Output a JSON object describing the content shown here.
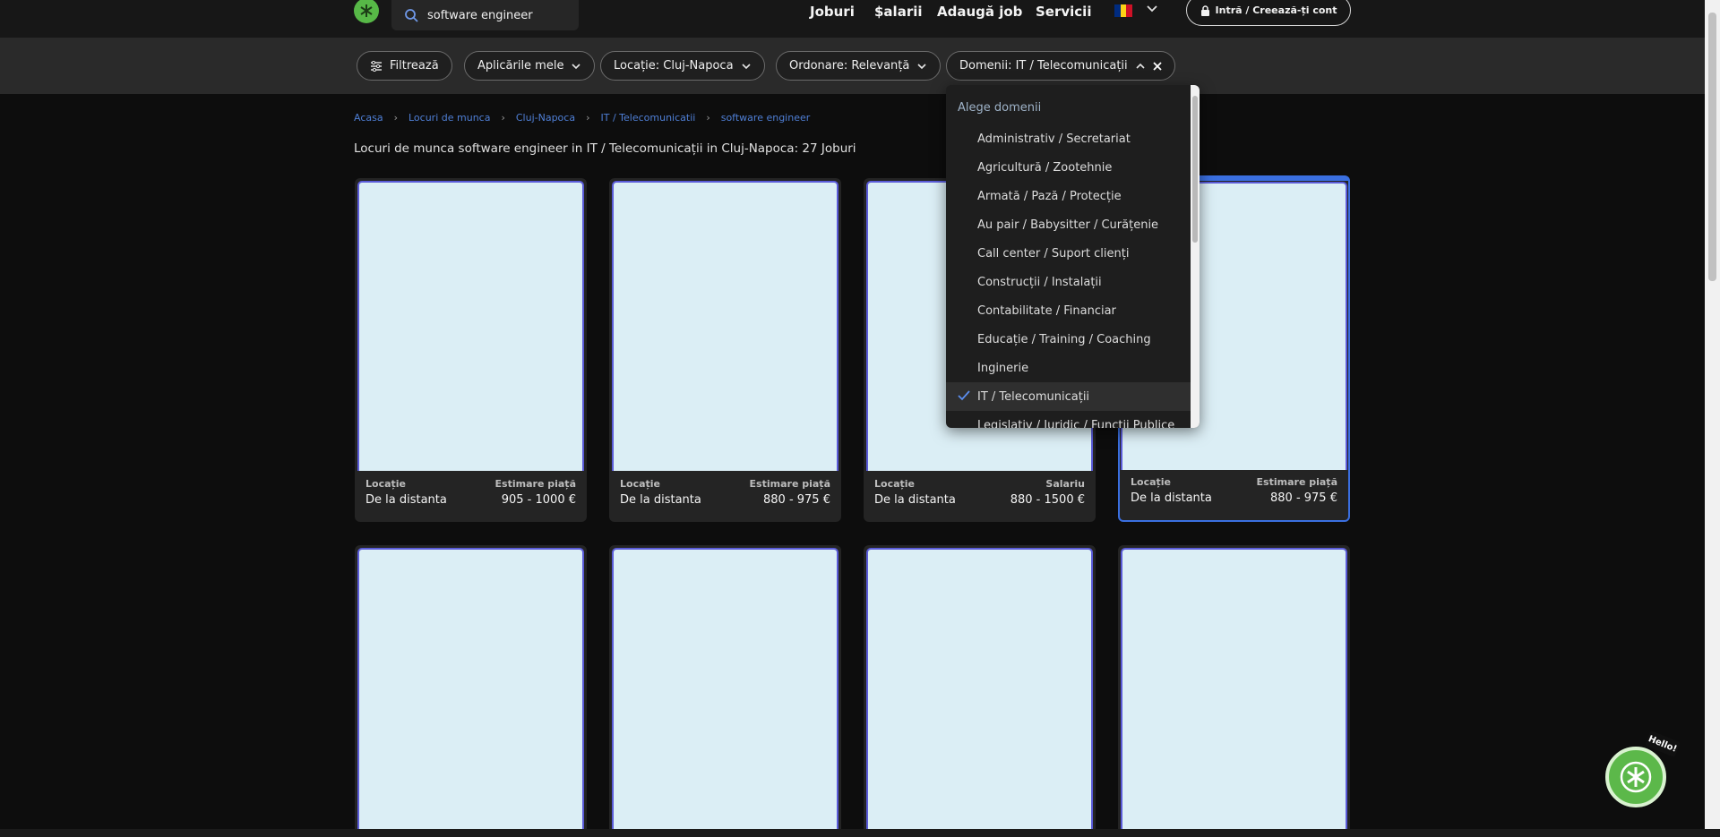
{
  "header": {
    "search_value": "software engineer",
    "nav": [
      "Joburi",
      "$alarii",
      "Adaugă job",
      "Servicii"
    ],
    "login_label": "Intră / Creează-ți cont",
    "flag_colors": [
      "#002b7f",
      "#fcd116",
      "#ce1126"
    ]
  },
  "filters": {
    "filter_label": "Filtrează",
    "applications_label": "Aplicările mele",
    "location_label": "Locație: Cluj-Napoca",
    "order_label": "Ordonare: Relevanță",
    "domains_label": "Domenii: IT / Telecomunicații"
  },
  "breadcrumb": [
    "Acasa",
    "Locuri de munca",
    "Cluj-Napoca",
    "IT / Telecomunicatii",
    "software engineer"
  ],
  "results_heading": "Locuri de munca software engineer in IT / Telecomunicații in Cluj-Napoca: 27 Joburi",
  "cards": [
    {
      "location_label": "Locație",
      "location": "De la distanta",
      "salary_label": "Estimare piață",
      "salary": "905 - 1000 €"
    },
    {
      "location_label": "Locație",
      "location": "De la distanta",
      "salary_label": "Estimare piață",
      "salary": "880 - 975 €"
    },
    {
      "location_label": "Locație",
      "location": "De la distanta",
      "salary_label": "Salariu",
      "salary": "880 - 1500 €"
    },
    {
      "location_label": "Locație",
      "location": "De la distanta",
      "salary_label": "Estimare piață",
      "salary": "880 - 975 €"
    }
  ],
  "dropdown": {
    "title": "Alege domenii",
    "items": [
      "Administrativ / Secretariat",
      "Agricultură / Zootehnie",
      "Armată / Pază / Protecție",
      "Au pair / Babysitter / Curățenie",
      "Call center / Suport clienți",
      "Construcții / Instalații",
      "Contabilitate / Financiar",
      "Educație / Training / Coaching",
      "Inginerie",
      "IT / Telecomunicații",
      "Legislativ / Juridic / Funcții Publice"
    ],
    "selected": "IT / Telecomunicații"
  },
  "chat": {
    "hello_label": "Hello!"
  },
  "colors": {
    "accent_blue": "#3a6fe0",
    "brand_green": "#57b847",
    "card_image": "#dbeef5"
  }
}
